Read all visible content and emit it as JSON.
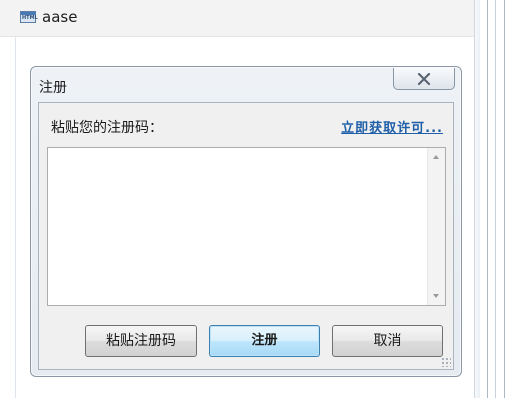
{
  "app": {
    "title": "aase",
    "icon": "html-file-icon",
    "icon_label": "HTML"
  },
  "dialog": {
    "title": "注册",
    "close_icon": "close-icon",
    "prompt": "粘贴您的注册码：",
    "license_link": "立即获取许可...",
    "license_code_value": "",
    "buttons": {
      "paste": "粘贴注册码",
      "register": "注册",
      "cancel": "取消"
    }
  },
  "colors": {
    "link": "#1f5fa8",
    "dialog_bg": "#eef2f6",
    "default_button_border": "#3c7fb1"
  }
}
